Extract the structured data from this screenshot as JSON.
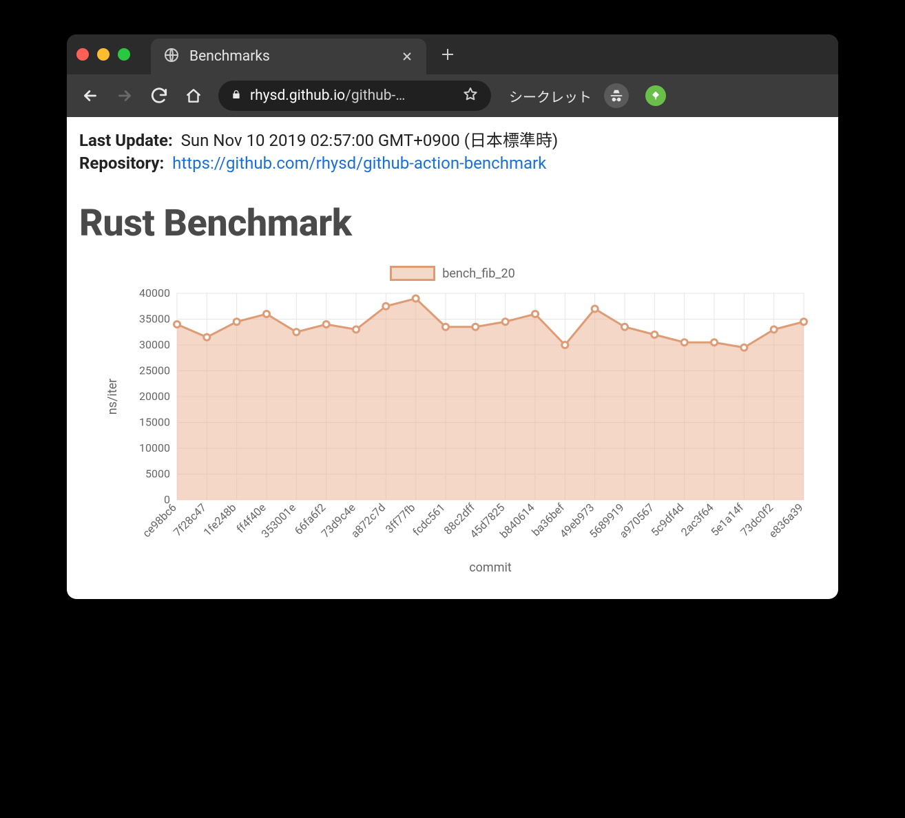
{
  "browser": {
    "tab_title": "Benchmarks",
    "url_host": "rhysd.github.io",
    "url_path": "/github-…",
    "incognito_label": "シークレット"
  },
  "page": {
    "last_update_label": "Last Update:",
    "last_update_value": "Sun Nov 10 2019 02:57:00 GMT+0900 (日本標準時)",
    "repository_label": "Repository:",
    "repository_url": "https://github.com/rhysd/github-action-benchmark",
    "heading": "Rust Benchmark"
  },
  "chart_data": {
    "type": "area",
    "title": "",
    "xlabel": "commit",
    "ylabel": "ns/iter",
    "ylim": [
      0,
      40000
    ],
    "yticks": [
      0,
      5000,
      10000,
      15000,
      20000,
      25000,
      30000,
      35000,
      40000
    ],
    "legend": "bench_fib_20",
    "categories": [
      "ce98bc6",
      "7f28c47",
      "1fe248b",
      "ff4f40e",
      "353001e",
      "66fa6f2",
      "73d9c4e",
      "a872c7d",
      "3ff77fb",
      "fcdc561",
      "88c2dff",
      "45d7825",
      "b840614",
      "ba36bef",
      "49eb973",
      "5689919",
      "a970567",
      "5c9df4d",
      "2ac3f64",
      "5e1a14f",
      "73dc0f2",
      "e836a39"
    ],
    "values": [
      34000,
      31500,
      34500,
      36000,
      32500,
      34000,
      33000,
      37500,
      39000,
      33500,
      33500,
      34500,
      36000,
      30000,
      37000,
      33500,
      32000,
      30500,
      30500,
      29500,
      33000,
      34500
    ]
  }
}
